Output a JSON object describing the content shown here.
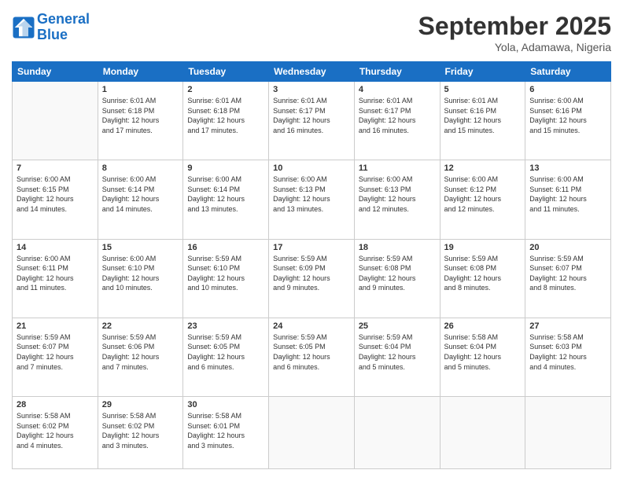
{
  "header": {
    "logo_line1": "General",
    "logo_line2": "Blue",
    "month": "September 2025",
    "location": "Yola, Adamawa, Nigeria"
  },
  "days_of_week": [
    "Sunday",
    "Monday",
    "Tuesday",
    "Wednesday",
    "Thursday",
    "Friday",
    "Saturday"
  ],
  "weeks": [
    [
      {
        "day": "",
        "info": ""
      },
      {
        "day": "1",
        "info": "Sunrise: 6:01 AM\nSunset: 6:18 PM\nDaylight: 12 hours\nand 17 minutes."
      },
      {
        "day": "2",
        "info": "Sunrise: 6:01 AM\nSunset: 6:18 PM\nDaylight: 12 hours\nand 17 minutes."
      },
      {
        "day": "3",
        "info": "Sunrise: 6:01 AM\nSunset: 6:17 PM\nDaylight: 12 hours\nand 16 minutes."
      },
      {
        "day": "4",
        "info": "Sunrise: 6:01 AM\nSunset: 6:17 PM\nDaylight: 12 hours\nand 16 minutes."
      },
      {
        "day": "5",
        "info": "Sunrise: 6:01 AM\nSunset: 6:16 PM\nDaylight: 12 hours\nand 15 minutes."
      },
      {
        "day": "6",
        "info": "Sunrise: 6:00 AM\nSunset: 6:16 PM\nDaylight: 12 hours\nand 15 minutes."
      }
    ],
    [
      {
        "day": "7",
        "info": "Sunrise: 6:00 AM\nSunset: 6:15 PM\nDaylight: 12 hours\nand 14 minutes."
      },
      {
        "day": "8",
        "info": "Sunrise: 6:00 AM\nSunset: 6:14 PM\nDaylight: 12 hours\nand 14 minutes."
      },
      {
        "day": "9",
        "info": "Sunrise: 6:00 AM\nSunset: 6:14 PM\nDaylight: 12 hours\nand 13 minutes."
      },
      {
        "day": "10",
        "info": "Sunrise: 6:00 AM\nSunset: 6:13 PM\nDaylight: 12 hours\nand 13 minutes."
      },
      {
        "day": "11",
        "info": "Sunrise: 6:00 AM\nSunset: 6:13 PM\nDaylight: 12 hours\nand 12 minutes."
      },
      {
        "day": "12",
        "info": "Sunrise: 6:00 AM\nSunset: 6:12 PM\nDaylight: 12 hours\nand 12 minutes."
      },
      {
        "day": "13",
        "info": "Sunrise: 6:00 AM\nSunset: 6:11 PM\nDaylight: 12 hours\nand 11 minutes."
      }
    ],
    [
      {
        "day": "14",
        "info": "Sunrise: 6:00 AM\nSunset: 6:11 PM\nDaylight: 12 hours\nand 11 minutes."
      },
      {
        "day": "15",
        "info": "Sunrise: 6:00 AM\nSunset: 6:10 PM\nDaylight: 12 hours\nand 10 minutes."
      },
      {
        "day": "16",
        "info": "Sunrise: 5:59 AM\nSunset: 6:10 PM\nDaylight: 12 hours\nand 10 minutes."
      },
      {
        "day": "17",
        "info": "Sunrise: 5:59 AM\nSunset: 6:09 PM\nDaylight: 12 hours\nand 9 minutes."
      },
      {
        "day": "18",
        "info": "Sunrise: 5:59 AM\nSunset: 6:08 PM\nDaylight: 12 hours\nand 9 minutes."
      },
      {
        "day": "19",
        "info": "Sunrise: 5:59 AM\nSunset: 6:08 PM\nDaylight: 12 hours\nand 8 minutes."
      },
      {
        "day": "20",
        "info": "Sunrise: 5:59 AM\nSunset: 6:07 PM\nDaylight: 12 hours\nand 8 minutes."
      }
    ],
    [
      {
        "day": "21",
        "info": "Sunrise: 5:59 AM\nSunset: 6:07 PM\nDaylight: 12 hours\nand 7 minutes."
      },
      {
        "day": "22",
        "info": "Sunrise: 5:59 AM\nSunset: 6:06 PM\nDaylight: 12 hours\nand 7 minutes."
      },
      {
        "day": "23",
        "info": "Sunrise: 5:59 AM\nSunset: 6:05 PM\nDaylight: 12 hours\nand 6 minutes."
      },
      {
        "day": "24",
        "info": "Sunrise: 5:59 AM\nSunset: 6:05 PM\nDaylight: 12 hours\nand 6 minutes."
      },
      {
        "day": "25",
        "info": "Sunrise: 5:59 AM\nSunset: 6:04 PM\nDaylight: 12 hours\nand 5 minutes."
      },
      {
        "day": "26",
        "info": "Sunrise: 5:58 AM\nSunset: 6:04 PM\nDaylight: 12 hours\nand 5 minutes."
      },
      {
        "day": "27",
        "info": "Sunrise: 5:58 AM\nSunset: 6:03 PM\nDaylight: 12 hours\nand 4 minutes."
      }
    ],
    [
      {
        "day": "28",
        "info": "Sunrise: 5:58 AM\nSunset: 6:02 PM\nDaylight: 12 hours\nand 4 minutes."
      },
      {
        "day": "29",
        "info": "Sunrise: 5:58 AM\nSunset: 6:02 PM\nDaylight: 12 hours\nand 3 minutes."
      },
      {
        "day": "30",
        "info": "Sunrise: 5:58 AM\nSunset: 6:01 PM\nDaylight: 12 hours\nand 3 minutes."
      },
      {
        "day": "",
        "info": ""
      },
      {
        "day": "",
        "info": ""
      },
      {
        "day": "",
        "info": ""
      },
      {
        "day": "",
        "info": ""
      }
    ]
  ]
}
